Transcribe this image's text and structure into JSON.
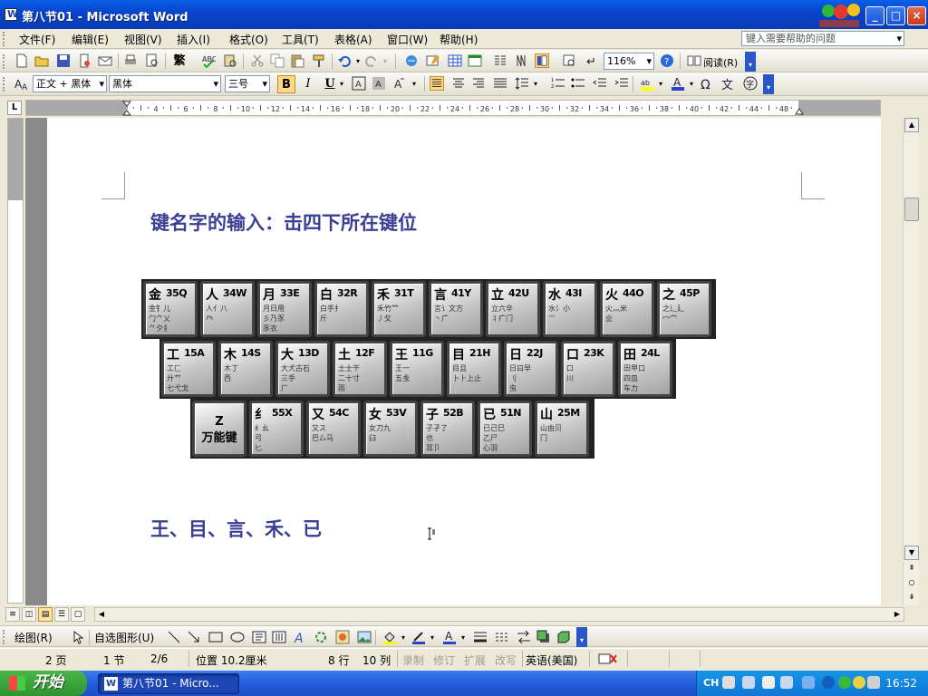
{
  "window": {
    "title": "第八节01 - Microsoft Word"
  },
  "menus": [
    "文件(F)",
    "编辑(E)",
    "视图(V)",
    "插入(I)",
    "格式(O)",
    "工具(T)",
    "表格(A)",
    "窗口(W)",
    "帮助(H)"
  ],
  "help": {
    "placeholder": "键入需要帮助的问题"
  },
  "toolbar": {
    "zoom": "116%",
    "read_label": "阅读(R)",
    "traditional_label": "繁"
  },
  "format": {
    "style": "正文 + 黑体",
    "font": "黑体",
    "size": "三号",
    "bold": "B",
    "italic": "I",
    "underline": "U"
  },
  "ruler": {
    "ticks": [
      "4",
      "2",
      "2",
      "4",
      "6",
      "8",
      "10",
      "12",
      "14",
      "16",
      "18",
      "20",
      "22",
      "24",
      "26",
      "28",
      "30",
      "32",
      "34",
      "36",
      "38",
      "40",
      "42",
      "44",
      "48",
      "50"
    ]
  },
  "document": {
    "heading": "键名字的输入：击四下所在键位",
    "answer": "王、目、言、禾、已"
  },
  "keyboard": {
    "row1": [
      {
        "main": "金",
        "code": "35Q",
        "roots": "金钅儿\n勹⺈乂\n⺈夕犭"
      },
      {
        "main": "人",
        "code": "34W",
        "roots": "人亻八\n癶"
      },
      {
        "main": "月",
        "code": "33E",
        "roots": "月日用\n彡乃豕\n豕衣"
      },
      {
        "main": "白",
        "code": "32R",
        "roots": "白手扌\n斤"
      },
      {
        "main": "禾",
        "code": "31T",
        "roots": "禾竹⺮\n丿攵"
      },
      {
        "main": "言",
        "code": "41Y",
        "roots": "言讠文方\n丶广"
      },
      {
        "main": "立",
        "code": "42U",
        "roots": "立六辛\n丬疒门"
      },
      {
        "main": "水",
        "code": "43I",
        "roots": "水氵小\n⺌"
      },
      {
        "main": "火",
        "code": "44O",
        "roots": "火灬米\n业"
      },
      {
        "main": "之",
        "code": "45P",
        "roots": "之辶廴\n冖宀"
      }
    ],
    "row2": [
      {
        "main": "工",
        "code": "15A",
        "roots": "工匚\n廾艹\n七弋戈"
      },
      {
        "main": "木",
        "code": "14S",
        "roots": "木丁\n西"
      },
      {
        "main": "大",
        "code": "13D",
        "roots": "大犬古石\n三手\n厂"
      },
      {
        "main": "土",
        "code": "12F",
        "roots": "土士干\n二十寸\n雨"
      },
      {
        "main": "王",
        "code": "11G",
        "roots": "王一\n五戋"
      },
      {
        "main": "目",
        "code": "21H",
        "roots": "目且\n卜⺊上止"
      },
      {
        "main": "日",
        "code": "22J",
        "roots": "日曰早\n刂\n虫"
      },
      {
        "main": "口",
        "code": "23K",
        "roots": "口\n川"
      },
      {
        "main": "田",
        "code": "24L",
        "roots": "田甲口\n四皿\n车力"
      }
    ],
    "row3": [
      {
        "big": "Z\n万能键"
      },
      {
        "main": "纟",
        "code": "55X",
        "roots": "纟幺\n弓\n匕"
      },
      {
        "main": "又",
        "code": "54C",
        "roots": "又ス\n巴厶马"
      },
      {
        "main": "女",
        "code": "53V",
        "roots": "女刀九\n臼"
      },
      {
        "main": "子",
        "code": "52B",
        "roots": "子孑了\n也\n耳卩"
      },
      {
        "main": "已",
        "code": "51N",
        "roots": "已己巳\n乙尸\n心羽"
      },
      {
        "main": "山",
        "code": "25M",
        "roots": "山由贝\n冂"
      }
    ]
  },
  "drawbar": {
    "draw_label": "绘图(R)",
    "autoshape_label": "自选图形(U)"
  },
  "status": {
    "page": "2 页",
    "section": "1 节",
    "pages": "2/6",
    "position": "位置 10.2厘米",
    "line": "8 行",
    "col": "10 列",
    "rec": "录制",
    "trk": "修订",
    "ext": "扩展",
    "ovr": "改写",
    "lang": "英语(美国)"
  },
  "taskbar": {
    "start": "开始",
    "item": "第八节01 - Micro...",
    "clock": "16:52",
    "ime": "CH"
  },
  "colors": {
    "heading": "#3a3f94",
    "titlebar": "#0a5fe8",
    "accent": "#ffd88a"
  }
}
